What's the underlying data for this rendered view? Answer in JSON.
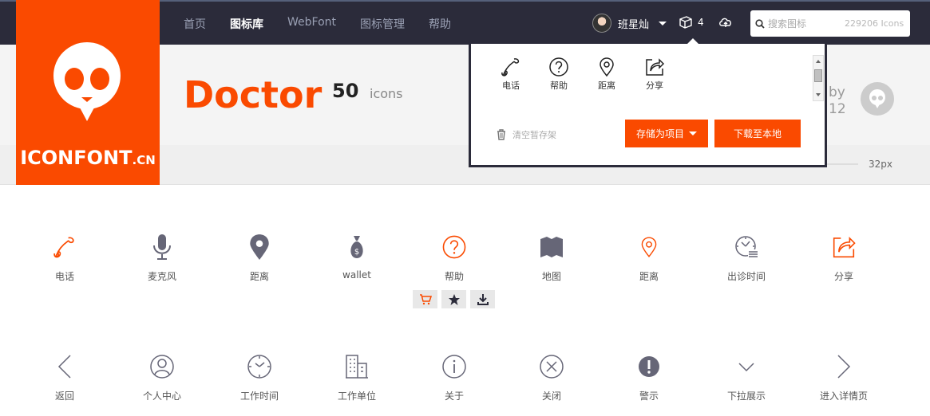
{
  "nav": {
    "items": [
      "首页",
      "图标库",
      "WebFont",
      "图标管理",
      "帮助"
    ],
    "active": "图标库"
  },
  "user": {
    "name": "班星灿"
  },
  "cart": {
    "count": "4"
  },
  "search": {
    "placeholder": "搜索图标",
    "count": "229206 Icons"
  },
  "logo": {
    "text": "ICONFONT",
    "suffix": ".CN"
  },
  "collection": {
    "title": "Doctor",
    "count": "50",
    "unit": "icons",
    "by_label": "by",
    "author_id": "12",
    "size": "32px"
  },
  "dropdown": {
    "items": [
      {
        "label": "电话",
        "icon": "phone-icon"
      },
      {
        "label": "帮助",
        "icon": "help-icon"
      },
      {
        "label": "距离",
        "icon": "location-icon"
      },
      {
        "label": "分享",
        "icon": "share-icon"
      }
    ],
    "clear_label": "清空暂存架",
    "save_label": "存储为项目",
    "download_label": "下载至本地"
  },
  "icons_row1": [
    {
      "label": "电话",
      "icon": "phone-icon"
    },
    {
      "label": "麦克风",
      "icon": "microphone-icon"
    },
    {
      "label": "距离",
      "icon": "location-filled-icon"
    },
    {
      "label": "wallet",
      "icon": "wallet-icon"
    },
    {
      "label": "帮助",
      "icon": "help-icon"
    },
    {
      "label": "地图",
      "icon": "map-icon"
    },
    {
      "label": "距离",
      "icon": "location-icon"
    },
    {
      "label": "出诊时间",
      "icon": "clock-list-icon"
    },
    {
      "label": "分享",
      "icon": "share-icon"
    }
  ],
  "icons_row2": [
    {
      "label": "返回",
      "icon": "chevron-left-icon"
    },
    {
      "label": "个人中心",
      "icon": "user-icon"
    },
    {
      "label": "工作时间",
      "icon": "clock-icon"
    },
    {
      "label": "工作单位",
      "icon": "building-icon"
    },
    {
      "label": "关于",
      "icon": "info-icon"
    },
    {
      "label": "关闭",
      "icon": "close-circle-icon"
    },
    {
      "label": "警示",
      "icon": "warning-icon"
    },
    {
      "label": "下拉展示",
      "icon": "chevron-down-icon"
    },
    {
      "label": "进入详情页",
      "icon": "chevron-right-icon"
    }
  ],
  "colors": {
    "accent": "#fa4a00",
    "topbar": "#2b2b3a",
    "icon_gray": "#666677"
  }
}
